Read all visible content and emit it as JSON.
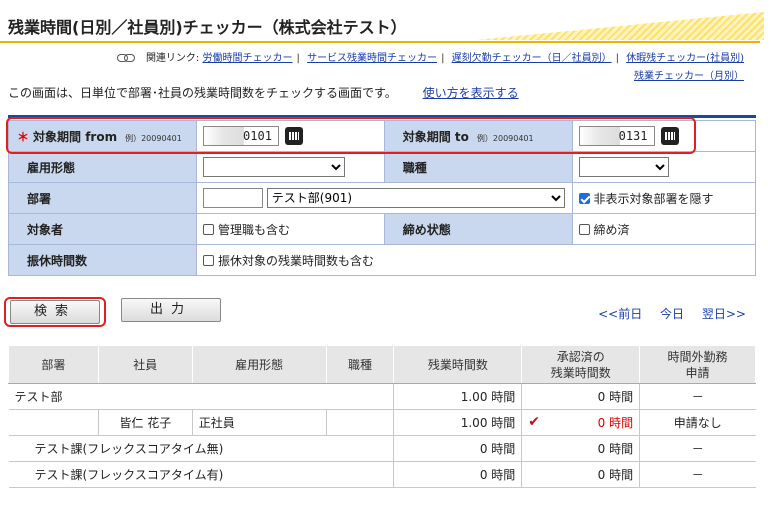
{
  "page": {
    "title": "残業時間(日別／社員別)チェッカー（株式会社テスト）",
    "intro": "この画面は、日単位で部署･社員の残業時間数をチェックする画面です。",
    "howto_link": "使い方を表示する"
  },
  "related": {
    "label": "関連リンク:",
    "links": [
      "労働時間チェッカー",
      "サービス残業時間チェッカー",
      "遅刻欠勤チェッカー（日／社員別）",
      "休暇残チェッカー(社員別)"
    ],
    "link_last": "残業チェッカー（月別）"
  },
  "form": {
    "from_label": "対象期間 from",
    "from_example": "例）20090401",
    "from_value": "0101",
    "to_label": "対象期間 to",
    "to_example": "例）20090401",
    "to_value": "0131",
    "employment_label": "雇用形態",
    "occupation_label": "職種",
    "dept_label": "部署",
    "dept_code": "",
    "dept_selected": "テスト部(901)",
    "hide_dept_label": "非表示対象部署を隠す",
    "target_label": "対象者",
    "manager_label": "管理職も含む",
    "closing_label": "締め状態",
    "closed_label": "締め済",
    "substitute_label": "振休時間数",
    "substitute_check_label": "振休対象の残業時間数も含む"
  },
  "buttons": {
    "search": "検索",
    "output": "出力"
  },
  "daynav": {
    "prev": "<<前日",
    "today": "今日",
    "next": "翌日>>"
  },
  "table": {
    "headers": [
      "部署",
      "社員",
      "雇用形態",
      "職種",
      "残業時間数",
      "承認済の\n残業時間数",
      "時間外勤務\n申請"
    ],
    "rows": [
      {
        "dept": "テスト部",
        "emp": "",
        "type": "",
        "job": "",
        "ot": "1.00 時間",
        "approved": "0 時間",
        "request": "－"
      },
      {
        "dept": "",
        "emp": "皆仁 花子",
        "type": "正社員",
        "job": "",
        "ot": "1.00 時間",
        "approved": "0 時間",
        "request": "申請なし"
      },
      {
        "dept": "テスト課(フレックスコアタイム無)",
        "emp": "",
        "type": "",
        "job": "",
        "ot": "0 時間",
        "approved": "0 時間",
        "request": "－"
      },
      {
        "dept": "テスト課(フレックスコアタイム有)",
        "emp": "",
        "type": "",
        "job": "",
        "ot": "0 時間",
        "approved": "0 時間",
        "request": "－"
      }
    ]
  }
}
